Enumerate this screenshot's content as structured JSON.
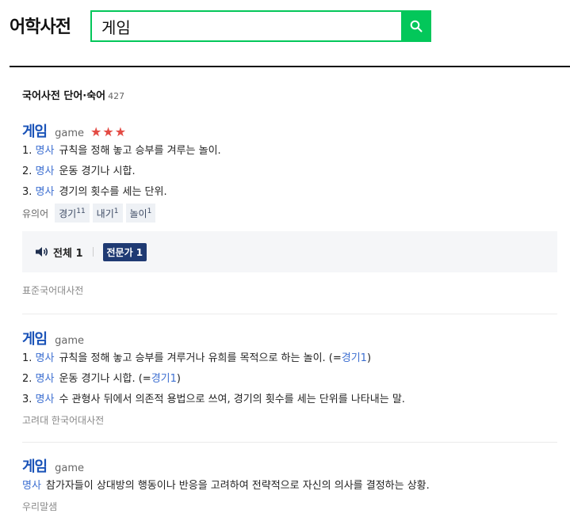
{
  "header": {
    "brand": "어학사전",
    "search_value": "게임"
  },
  "section": {
    "title": "국어사전 단어·숙어",
    "count": "427"
  },
  "entries": [
    {
      "headword": "게임",
      "origin": "game",
      "stars": "★★★",
      "defs": [
        {
          "num": "1.",
          "pos": "명사",
          "text": "규칙을 정해 놓고 승부를 겨루는 놀이."
        },
        {
          "num": "2.",
          "pos": "명사",
          "text": "운동 경기나 시합."
        },
        {
          "num": "3.",
          "pos": "명사",
          "text": "경기의 횟수를 세는 단위."
        }
      ],
      "synonyms_label": "유의어",
      "synonyms": [
        {
          "word": "경기",
          "sup": "11"
        },
        {
          "word": "내기",
          "sup": "1"
        },
        {
          "word": "놀이",
          "sup": "1"
        }
      ],
      "audio_all": "전체 1",
      "expert": "전문가 1",
      "source": "표준국어대사전"
    },
    {
      "headword": "게임",
      "origin": "game",
      "defs": [
        {
          "num": "1.",
          "pos": "명사",
          "text": "규칙을 정해 놓고 승부를 겨루거나 유희를 목적으로 하는 놀이. (=",
          "ref": "경기1",
          "tail": ")"
        },
        {
          "num": "2.",
          "pos": "명사",
          "text": "운동 경기나 시합. (=",
          "ref": "경기1",
          "tail": ")"
        },
        {
          "num": "3.",
          "pos": "명사",
          "text": "수 관형사 뒤에서 의존적 용법으로 쓰여, 경기의 횟수를 세는 단위를 나타내는 말."
        }
      ],
      "source": "고려대 한국어대사전"
    },
    {
      "headword": "게임",
      "origin": "game",
      "defs": [
        {
          "pos": "명사",
          "text": "참가자들이 상대방의 행동이나 반응을 고려하여 전략적으로 자신의 의사를 결정하는 상황."
        }
      ],
      "source": "우리말샘"
    }
  ],
  "colors": {
    "brand_green": "#03c75a",
    "headword_blue": "#1a53b8",
    "star_red": "#e34b44",
    "expert_navy": "#1f3a73"
  },
  "icons": {
    "search": "search-icon",
    "speaker": "speaker-icon"
  }
}
